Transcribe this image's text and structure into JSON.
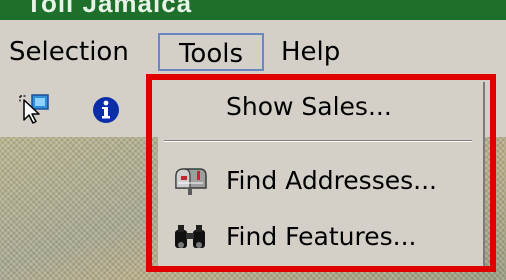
{
  "window": {
    "title": "Toll Jamaica"
  },
  "menubar": {
    "items": [
      "Selection",
      "Tools",
      "Help"
    ],
    "active": "Tools"
  },
  "toolbar": {
    "buttons": [
      {
        "icon": "select-features-icon"
      },
      {
        "icon": "info-icon"
      }
    ]
  },
  "tools_menu": {
    "items": [
      {
        "label": "Show Sales...",
        "icon": ""
      },
      {
        "label": "Find Addresses...",
        "icon": "mailbox-icon"
      },
      {
        "label": "Find Features...",
        "icon": "binoculars-icon"
      }
    ]
  },
  "highlight": {
    "color": "#e00000"
  }
}
